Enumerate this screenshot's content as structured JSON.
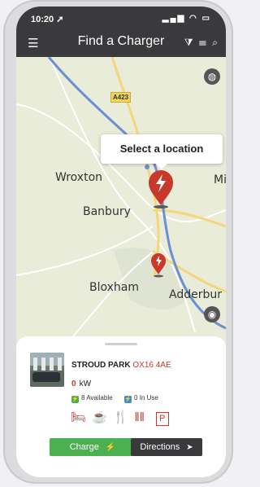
{
  "status": {
    "time": "10:20",
    "indicators": "..il ◠ ▬"
  },
  "header": {
    "title": "Find a Charger",
    "menu_icon": "hamburger-icon",
    "filter_icon": "filter-icon",
    "list_icon": "list-icon",
    "search_icon": "search-icon"
  },
  "map": {
    "places": [
      "Wroxton",
      "Mi",
      "Banbury",
      "Bloxham",
      "Adderbur"
    ],
    "road_label": "A423",
    "callout": "Select a location",
    "colors": {
      "pin": "#c8392b",
      "road_motorway": "#6a8fd4",
      "road_a": "#f5d77a"
    }
  },
  "card": {
    "site_name": "STROUD PARK",
    "postcode": "OX16 4AE",
    "power_value": "0",
    "power_unit": "kW",
    "available": "8 Available",
    "in_use": "0 In Use",
    "amenities": [
      "bed-icon",
      "coffee-icon",
      "restaurant-icon",
      "food-icon",
      "parking-icon"
    ],
    "parking_label": "P",
    "charge_label": "Charge",
    "directions_label": "Directions"
  }
}
